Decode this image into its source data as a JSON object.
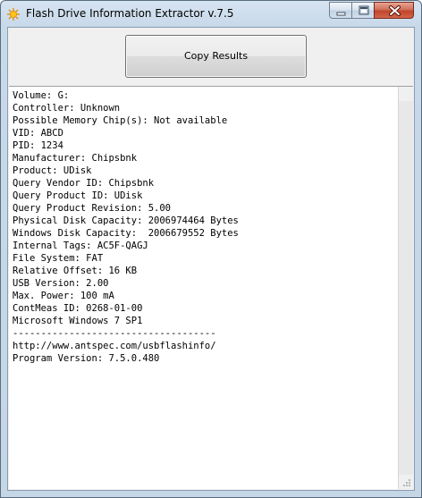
{
  "window": {
    "title": "Flash Drive Information Extractor v.7.5"
  },
  "toolbar": {
    "copy_label": "Copy Results"
  },
  "results": {
    "lines": [
      "Volume: G:",
      "Controller: Unknown",
      "Possible Memory Chip(s): Not available",
      "VID: ABCD",
      "PID: 1234",
      "Manufacturer: Chipsbnk",
      "Product: UDisk",
      "Query Vendor ID: Chipsbnk",
      "Query Product ID: UDisk",
      "Query Product Revision: 5.00",
      "Physical Disk Capacity: 2006974464 Bytes",
      "Windows Disk Capacity:  2006679552 Bytes",
      "Internal Tags: AC5F-QAGJ",
      "File System: FAT",
      "Relative Offset: 16 KB",
      "USB Version: 2.00",
      "Max. Power: 100 mA",
      "ContMeas ID: 0268-01-00",
      "Microsoft Windows 7 SP1",
      "------------------------------------",
      "http://www.antspec.com/usbflashinfo/",
      "Program Version: 7.5.0.480"
    ]
  },
  "icons": {
    "app": "sun-icon",
    "minimize": "minimize-icon",
    "maximize": "maximize-icon",
    "close": "close-icon"
  }
}
